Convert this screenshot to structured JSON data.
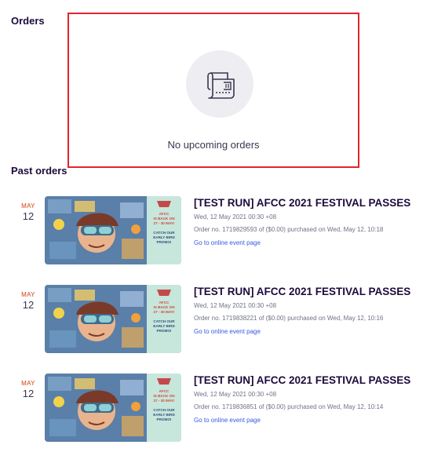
{
  "orders": {
    "heading": "Orders",
    "empty_message": "No upcoming orders",
    "icon": "ticket-icon",
    "panel_highlight_color": "#e0252f"
  },
  "past_orders": {
    "heading": "Past orders",
    "items": [
      {
        "month": "MAY",
        "day": "12",
        "title": "[TEST RUN] AFCC 2021 FESTIVAL PASSES",
        "event_date": "Wed, 12 May 2021 00:30 +08",
        "order_meta": "Order no. 1719829593 of ($0.00) purchased on Wed, May 12, 10:18",
        "link": "Go to online event page",
        "thumb_text": [
          "AFCC",
          "IS BACK ON",
          "27 - 30 MAY!",
          "CATCH OUR",
          "EARLY BIRD",
          "PROMO!"
        ]
      },
      {
        "month": "MAY",
        "day": "12",
        "title": "[TEST RUN] AFCC 2021 FESTIVAL PASSES",
        "event_date": "Wed, 12 May 2021 00:30 +08",
        "order_meta": "Order no. 1719838221 of ($0.00) purchased on Wed, May 12, 10:16",
        "link": "Go to online event page",
        "thumb_text": [
          "AFCC",
          "IS BACK ON",
          "27 - 30 MAY!",
          "CATCH OUR",
          "EARLY BIRD",
          "PROMO!"
        ]
      },
      {
        "month": "MAY",
        "day": "12",
        "title": "[TEST RUN] AFCC 2021 FESTIVAL PASSES",
        "event_date": "Wed, 12 May 2021 00:30 +08",
        "order_meta": "Order no. 1719836851 of ($0.00) purchased on Wed, May 12, 10:14",
        "link": "Go to online event page",
        "thumb_text": [
          "AFCC",
          "IS BACK ON",
          "27 - 30 MAY!",
          "CATCH OUR",
          "EARLY BIRD",
          "PROMO!"
        ]
      }
    ]
  }
}
